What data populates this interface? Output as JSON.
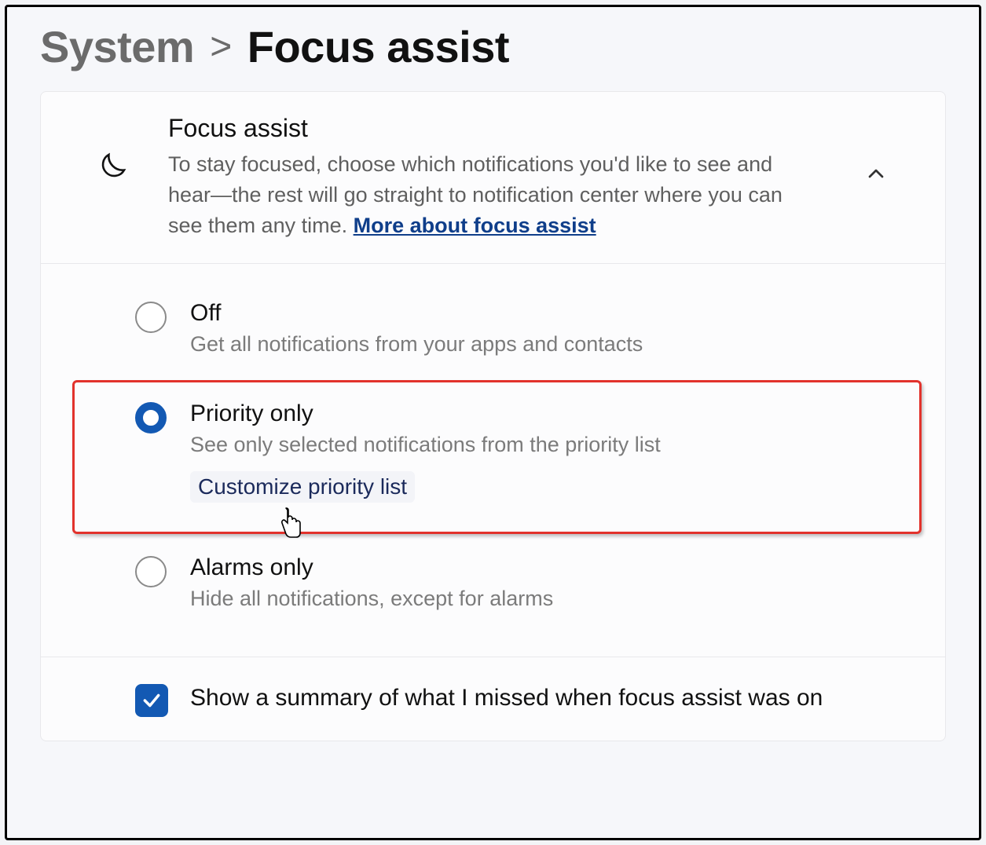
{
  "breadcrumb": {
    "parent": "System",
    "separator": ">",
    "current": "Focus assist"
  },
  "header": {
    "title": "Focus assist",
    "description_part1": "To stay focused, choose which notifications you'd like to see and hear—the rest will go straight to notification center where you can see them any time.  ",
    "link_text": "More about focus assist"
  },
  "options": {
    "off": {
      "title": "Off",
      "subtitle": "Get all notifications from your apps and contacts"
    },
    "priority": {
      "title": "Priority only",
      "subtitle": "See only selected notifications from the priority list",
      "customize_link": "Customize priority list"
    },
    "alarms": {
      "title": "Alarms only",
      "subtitle": "Hide all notifications, except for alarms"
    },
    "selected": "priority"
  },
  "summary_checkbox": {
    "label": "Show a summary of what I missed when focus assist was on",
    "checked": true
  }
}
